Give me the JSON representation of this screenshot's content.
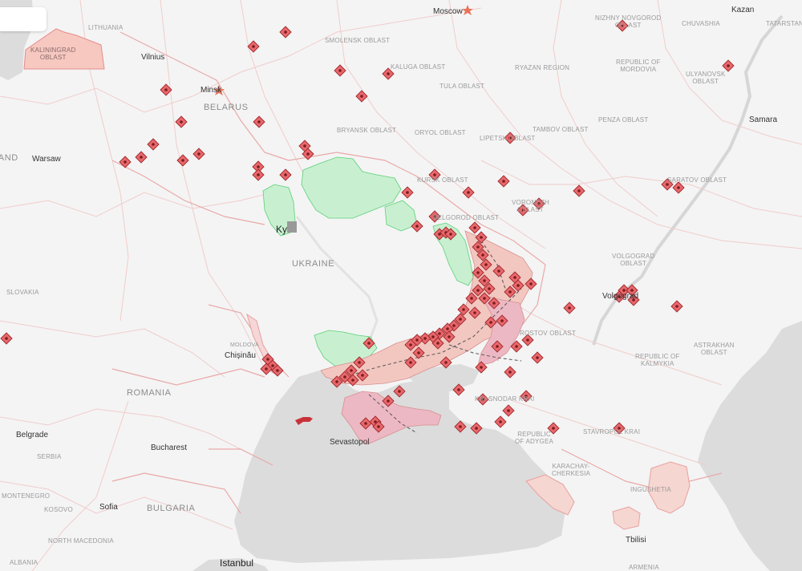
{
  "colors": {
    "land": "#f4f4f4",
    "sea": "#dcdcdc",
    "border": "#f0c8c8",
    "occupied": "#f2c7c0",
    "crimea": "#ecb8c4",
    "liberated": "#c8f0d0",
    "strike_fill": "#e8686c",
    "strike_stroke": "#9e2a2e",
    "kyiv_marker": "#999999"
  },
  "labels": {
    "moscow": "Moscow",
    "kazan": "Kazan",
    "tatarstan": "TATARSTAN",
    "chuvashia": "CHUVASHIA",
    "nizhny": "NIZHNY NOVGOROD\nOBLAST",
    "smolensk": "SMOLENSK OBLAST",
    "kaluga": "KALUGA OBLAST",
    "ryazan": "RYAZAN REGION",
    "mordovia": "REPUBLIC OF\nMORDOVIA",
    "ulyanovsk": "ULYANOVSK\nOBLAST",
    "samara": "Samara",
    "tula": "TULA OBLAST",
    "penza": "PENZA OBLAST",
    "bryansk": "BRYANSK OBLAST",
    "oryol": "ORYOL OBLAST",
    "lipetsk": "LIPETSK OBLAST",
    "tambov": "TAMBOV OBLAST",
    "kursk": "KURSK OBLAST",
    "saratov": "SARATOV OBLAST",
    "voronezh": "VORONEZH\nOBLAST",
    "belgorod": "BELGOROD OBLAST",
    "volgograd_oblast": "VOLGOGRAD\nOBLAST",
    "volgograd": "Volgograd",
    "rostov": "ROSTOV OBLAST",
    "astrakhan": "ASTRAKHAN\nOBLAST",
    "kalmykia": "REPUBLIC OF\nKALMYKIA",
    "krasnodar": "KRASNODAR KRAI",
    "adygea": "REPUBLIC\nOF ADYGEA",
    "stavropol": "STAVROPOL KRAI",
    "karachay": "KARACHAY-\nCHERKESIA",
    "ingushetia": "INGUSHETIA",
    "tbilisi": "Tbilisi",
    "armenia": "ARMENIA",
    "kaliningrad": "KALININGRAD\nOBLAST",
    "lithuania": "LITHUANIA",
    "vilnius": "Vilnius",
    "minsk": "Minsk",
    "belarus": "BELARUS",
    "poland": "POLAND",
    "warsaw": "Warsaw",
    "kyiv": "Kyiv",
    "ukraine": "UKRAINE",
    "slovakia": "SLOVAKIA",
    "moldova": "MOLDOVA",
    "chisinau": "Chișinău",
    "romania": "ROMANIA",
    "bucharest": "Bucharest",
    "belgrade": "Belgrade",
    "serbia": "SERBIA",
    "montenegro": "MONTENEGRO",
    "kosovo": "KOSOVO",
    "sofia": "Sofia",
    "bulgaria": "BULGARIA",
    "north_macedonia": "NORTH MACEDONIA",
    "albania": "ALBANIA",
    "sevastopol": "Sevastopol",
    "istanbul": "Istanbul"
  },
  "icons": {
    "strike": "strike-marker-icon",
    "capital": "capital-star-icon",
    "aircraft": "aircraft-icon",
    "kyiv": "kyiv-square-icon"
  }
}
